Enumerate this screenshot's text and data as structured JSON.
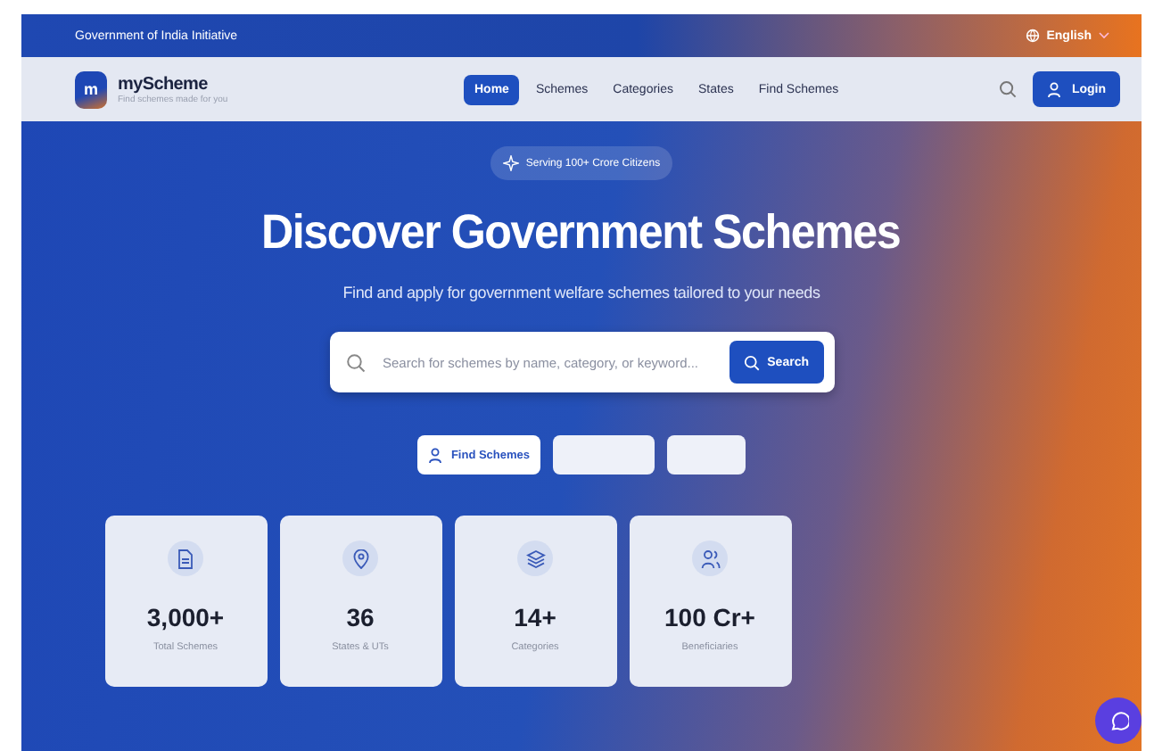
{
  "top_bar": {
    "text": "Government of India Initiative",
    "language": "English"
  },
  "header": {
    "logo_letter": "m",
    "brand": "myScheme",
    "tagline": "Find schemes made for you",
    "nav": [
      {
        "label": "Home",
        "selected": true
      },
      {
        "label": "Schemes",
        "selected": false
      },
      {
        "label": "Categories",
        "selected": false
      },
      {
        "label": "States",
        "selected": false
      },
      {
        "label": "Find Schemes",
        "selected": false
      }
    ],
    "login": "Login"
  },
  "hero": {
    "badge": "Serving 100+ Crore Citizens",
    "title": "Discover Government Schemes",
    "subtitle": "Find and apply for government welfare schemes tailored to your needs",
    "search": {
      "placeholder": "Search for schemes by name, category, or keyword...",
      "button": "Search"
    },
    "quick_buttons": [
      {
        "kind": "labeled",
        "label": "Find Schemes"
      },
      {
        "kind": "blank"
      },
      {
        "kind": "blank"
      }
    ],
    "stats": [
      {
        "kind": "document",
        "value": "3,000+",
        "label": "Total Schemes"
      },
      {
        "kind": "pin",
        "value": "36",
        "label": "States & UTs"
      },
      {
        "kind": "layers",
        "value": "14+",
        "label": "Categories"
      },
      {
        "kind": "users",
        "value": "100 Cr+",
        "label": "Beneficiaries"
      }
    ]
  }
}
